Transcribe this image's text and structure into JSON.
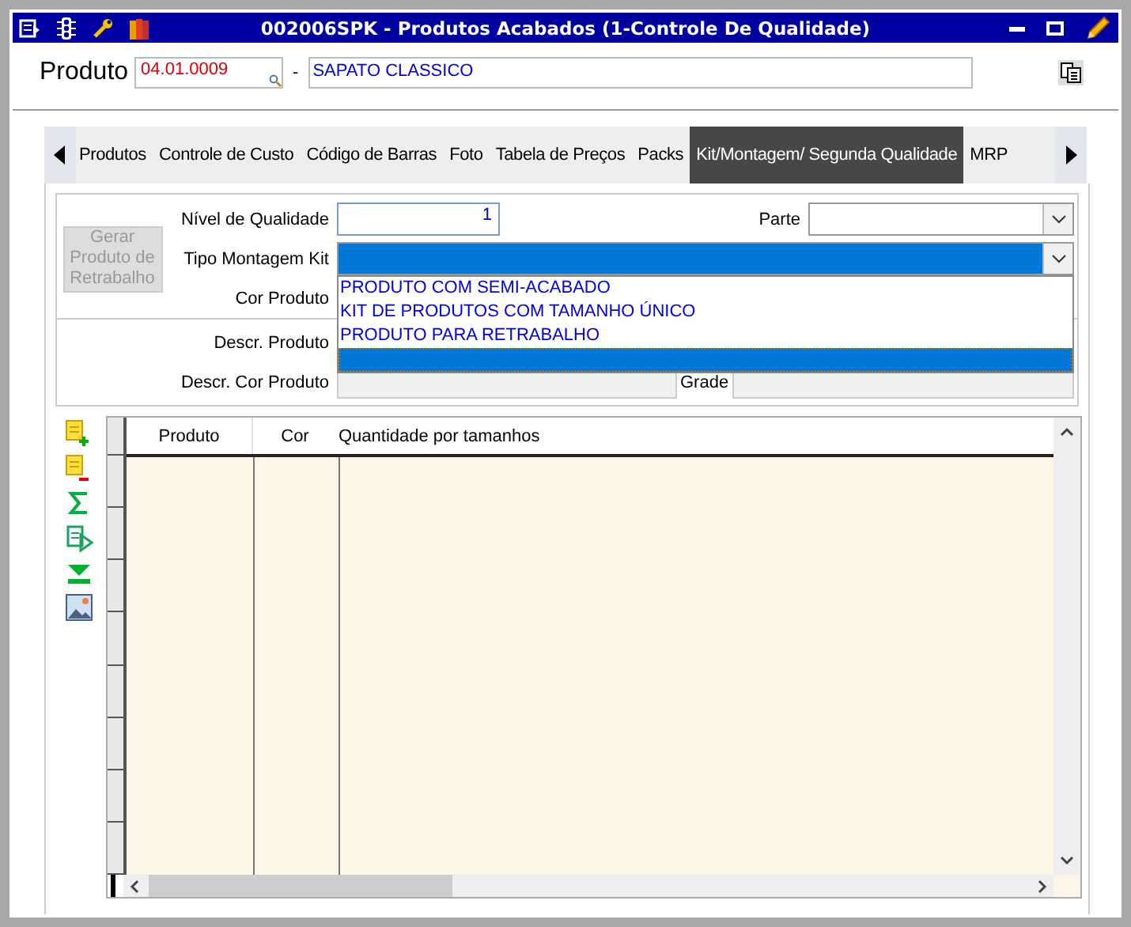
{
  "window": {
    "title": "002006SPK - Produtos Acabados (1-Controle De Qualidade)"
  },
  "product": {
    "label": "Produto",
    "code": "04.01.0009",
    "separator": "-",
    "name": "SAPATO CLASSICO"
  },
  "tabs": [
    {
      "label": "Produtos",
      "selected": false
    },
    {
      "label": "Controle de Custo",
      "selected": false
    },
    {
      "label": "Código de Barras",
      "selected": false
    },
    {
      "label": "Foto",
      "selected": false
    },
    {
      "label": "Tabela de Preços",
      "selected": false
    },
    {
      "label": "Packs",
      "selected": false
    },
    {
      "label": "Kit/Montagem/ Segunda Qualidade",
      "selected": true
    },
    {
      "label": "MRP",
      "selected": false
    }
  ],
  "form": {
    "generate_button": {
      "label": "Gerar Produto de Retrabalho",
      "disabled": true
    },
    "quality_level": {
      "label": "Nível de Qualidade",
      "value": "1"
    },
    "part": {
      "label": "Parte"
    },
    "kit_type": {
      "label": "Tipo Montagem Kit",
      "options": [
        {
          "label": "PRODUTO COM SEMI-ACABADO",
          "selected": false
        },
        {
          "label": "KIT DE PRODUTOS COM TAMANHO ÚNICO",
          "selected": false
        },
        {
          "label": "PRODUTO PARA RETRABALHO",
          "selected": false
        },
        {
          "selected": true
        }
      ]
    },
    "color_label": "Cor Produto",
    "descr_label": "Descr. Produto",
    "descr_color_label": "Descr. Cor Produto",
    "grade_label": "Grade"
  },
  "table": {
    "columns": [
      "Produto",
      "Cor",
      "Quantidade por tamanhos"
    ]
  }
}
